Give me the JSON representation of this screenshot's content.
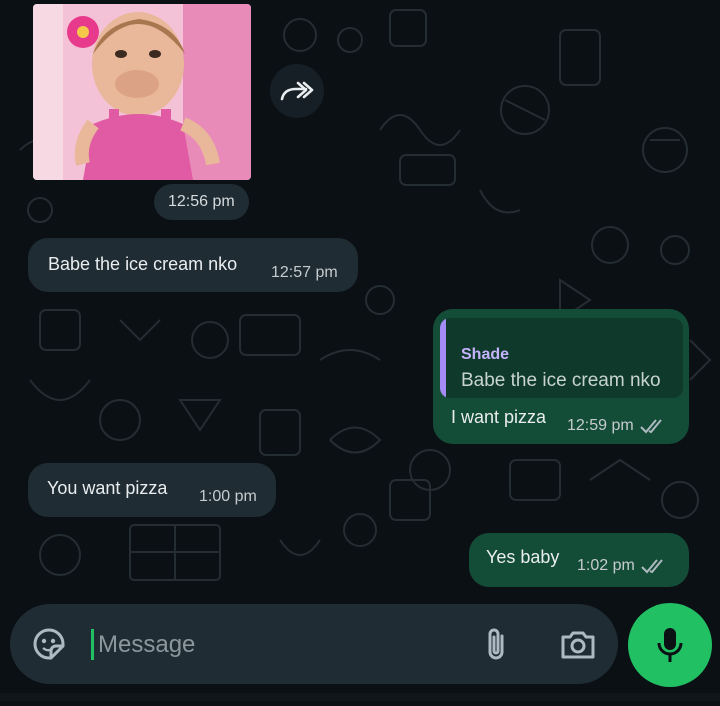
{
  "colors": {
    "background": "#0b1014",
    "incoming_bubble": "#1f2c33",
    "outgoing_bubble": "#144d37",
    "accent": "#21c063",
    "quote_bar": "#a58bf6"
  },
  "media_message": {
    "kind": "image",
    "time": "12:56 pm"
  },
  "messages": [
    {
      "direction": "incoming",
      "text": "Babe the ice cream nko",
      "time": "12:57 pm"
    },
    {
      "direction": "outgoing",
      "reply_to": {
        "author": "Shade",
        "text": "Babe the ice cream nko"
      },
      "text": "I want pizza",
      "time": "12:59 pm",
      "status": "read-double-check"
    },
    {
      "direction": "incoming",
      "text": "You want pizza",
      "time": "1:00 pm"
    },
    {
      "direction": "outgoing",
      "text": "Yes baby",
      "time": "1:02 pm",
      "status": "read-double-check"
    }
  ],
  "composer": {
    "placeholder": "Message",
    "icons": [
      "sticker-icon",
      "attach-icon",
      "camera-icon",
      "mic-icon"
    ]
  }
}
